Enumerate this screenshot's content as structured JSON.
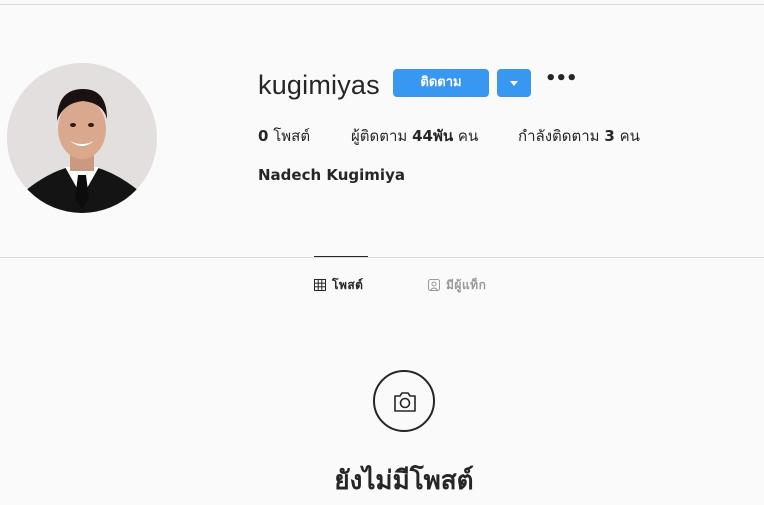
{
  "profile": {
    "username": "kugimiyas",
    "follow_label": "ติดตาม",
    "full_name": "Nadech Kugimiya"
  },
  "stats": {
    "posts_count": "0",
    "posts_label": "โพสต์",
    "followers_label": "ผู้ติดตาม",
    "followers_count": "44พัน",
    "followers_unit": "คน",
    "following_label": "กำลังติดตาม",
    "following_count": "3",
    "following_unit": "คน"
  },
  "tabs": [
    {
      "label": "โพสต์",
      "icon": "grid-icon",
      "active": true
    },
    {
      "label": "มีผู้แท็ก",
      "icon": "tagged-icon",
      "active": false
    }
  ],
  "empty_state": {
    "icon": "camera-icon",
    "title": "ยังไม่มีโพสต์"
  },
  "colors": {
    "accent": "#3897f0",
    "text": "#262626",
    "muted": "#999999",
    "background": "#fafafa",
    "border": "#dbdbdb"
  }
}
